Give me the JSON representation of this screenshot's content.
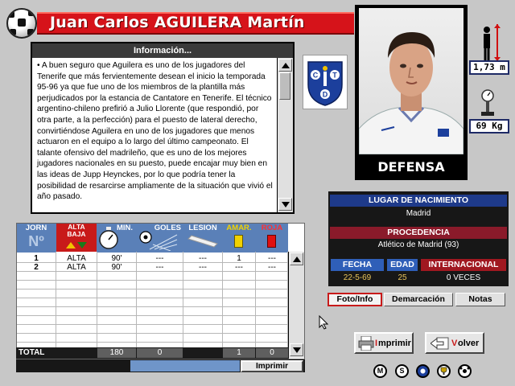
{
  "player": {
    "name": "Juan Carlos AGUILERA Martín",
    "position": "DEFENSA",
    "height": "1,73 m",
    "weight": "69 Kg"
  },
  "club_crest": {
    "letters": [
      "C",
      "T",
      "D"
    ],
    "colors": {
      "blue": "#1c3f9c",
      "white": "#ffffff"
    }
  },
  "info": {
    "title": "Información...",
    "text": "• A buen seguro que Aguilera es uno de los jugadores del Tenerife que más fervientemente desean el inicio la temporada 95-96 ya que fue uno de los miembros de la plantilla más perjudicados por la estancia de Cantatore en Tenerife. El técnico argentino-chileno prefirió a Julio Llorente (que respondió, por otra parte, a la perfección) para el puesto de lateral derecho, convirtiéndose Aguilera en uno de los jugadores que menos actuaron en el equipo a lo largo del último campeonato. El talante ofensivo del madrileño, que es uno de los mejores jugadores nacionales en su puesto, puede encajar muy bien en las ideas de Jupp Heynckes, por lo que podría tener la posibilidad de resarcirse ampliamente de la situación que vivió el año pasado."
  },
  "birth": {
    "lugar_label": "LUGAR DE NACIMIENTO",
    "lugar_value": "Madrid",
    "procedencia_label": "PROCEDENCIA",
    "procedencia_value": "Atlético de Madrid (93)",
    "fecha_label": "FECHA",
    "fecha_value": "22-5-69",
    "edad_label": "EDAD",
    "edad_value": "25",
    "internacional_label": "INTERNACIONAL",
    "internacional_value": "0 VECES"
  },
  "tabs": [
    "Foto/Info",
    "Demarcación",
    "Notas"
  ],
  "stats": {
    "headers": {
      "jorn": "JORN",
      "jorn_sub": "Nº",
      "alta_baja": "ALTA BAJA",
      "min": "MIN.",
      "goles": "GOLES",
      "lesion": "LESION",
      "amar": "AMAR.",
      "roja": "ROJA"
    },
    "rows": [
      {
        "jorn": "1",
        "alta": "ALTA",
        "min": "90'",
        "goles": "---",
        "lesion": "---",
        "amar": "1",
        "roja": "---"
      },
      {
        "jorn": "2",
        "alta": "ALTA",
        "min": "90'",
        "goles": "---",
        "lesion": "---",
        "amar": "---",
        "roja": "---"
      }
    ],
    "total_label": "TOTAL",
    "total_min": "180",
    "total_goles": "0",
    "total_amar": "1",
    "total_roja": "0",
    "print_label": "Imprimir"
  },
  "buttons": {
    "imprimir_first": "I",
    "imprimir_rest": "mprimir",
    "volver_first": "V",
    "volver_rest": "olver"
  },
  "nav_icons": [
    "M",
    "S"
  ],
  "colors": {
    "title_red": "#d6131a",
    "panel_dark": "#171717",
    "accent_red": "#c81a1a",
    "accent_blue": "#1e3a8a"
  }
}
